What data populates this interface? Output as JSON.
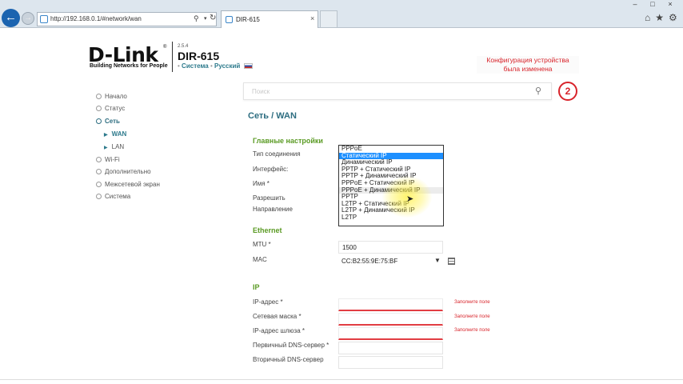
{
  "browser": {
    "address": "http://192.168.0.1/#network/wan",
    "tab_title": "DIR-615",
    "tab_close": "×",
    "back": "←",
    "forward": "→",
    "window_controls": [
      "–",
      "□",
      "×"
    ],
    "toolbar_icons": [
      "⌂",
      "★",
      "⚙"
    ]
  },
  "header": {
    "logo": "D-Link",
    "logo_tm": "®",
    "tagline": "Building Networks for People",
    "fw_version": "2.5.4",
    "model": "DIR-615",
    "crumb_system": "Система",
    "crumb_lang": "Русский",
    "notice_line1": "Конфигурация устройства",
    "notice_line2": "была изменена",
    "search_placeholder": "Поиск",
    "notif_count": "2"
  },
  "sidebar": {
    "items": [
      "Начало",
      "Статус",
      "Сеть",
      "WAN",
      "LAN",
      "Wi-Fi",
      "Дополнительно",
      "Межсетевой экран",
      "Система"
    ]
  },
  "content": {
    "title": "Сеть /  WAN",
    "main_section": "Главные настройки",
    "labels": {
      "conn_type": "Тип соединения",
      "interface": "Интерфейс:",
      "name": "Имя *",
      "allow": "Разрешить",
      "direction": "Направление"
    },
    "conn_options": [
      "PPPoE",
      "Статический IP",
      "Динамический IP",
      "PPTP + Статический IP",
      "PPTP + Динамический IP",
      "PPPoE + Статический IP",
      "PPPoE + Динамический IP",
      "PPTP",
      "L2TP + Статический IP",
      "L2TP + Динамический IP",
      "L2TP"
    ],
    "ethernet_section": "Ethernet",
    "mtu_label": "MTU *",
    "mtu_value": "1500",
    "mac_label": "MAC",
    "mac_value": "CC:B2:55:9E:75:BF",
    "ip_section": "IP",
    "ip_address_label": "IP-адрес *",
    "netmask_label": "Сетевая маска *",
    "gateway_label": "IP-адрес шлюза *",
    "dns1_label": "Первичный DNS-сервер *",
    "dns2_label": "Вторичный DNS-сервер",
    "error": "Заполните поле"
  },
  "colors": {
    "accent": "#2d6d80",
    "section": "#5a9a23",
    "error": "#d8232a",
    "selected": "#1e90ff"
  }
}
